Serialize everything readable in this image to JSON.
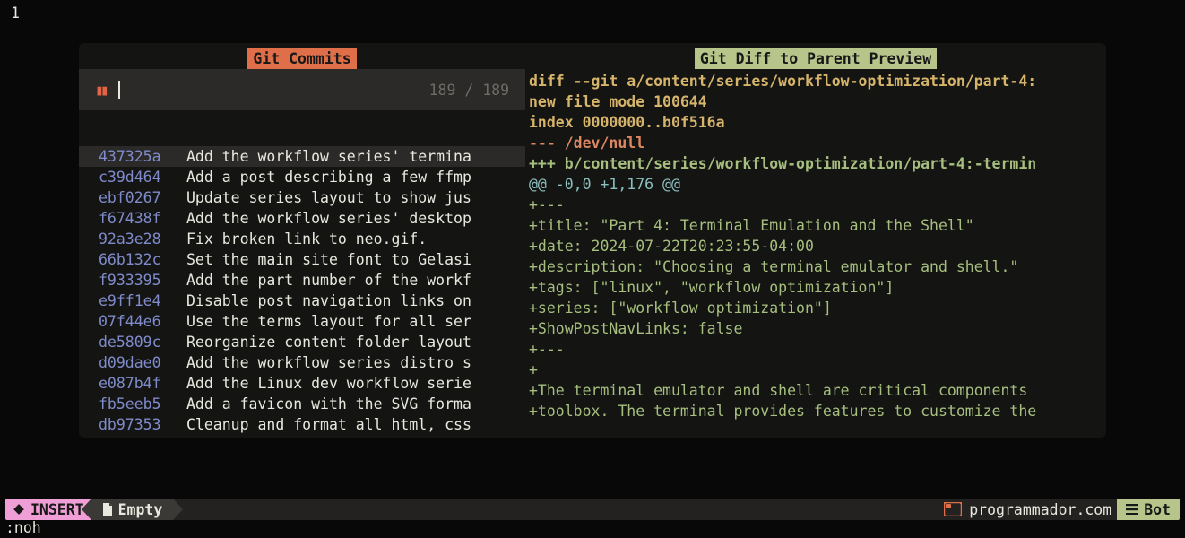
{
  "gutter_line": "1",
  "left": {
    "title": "Git Commits",
    "search": {
      "icon": "⫼",
      "count": "189 / 189"
    },
    "commits": [
      {
        "hash": "437325a",
        "msg": "Add the workflow series' termina",
        "active": true
      },
      {
        "hash": "c39d464",
        "msg": "Add a post describing a few ffmp"
      },
      {
        "hash": "ebf0267",
        "msg": "Update series layout to show jus"
      },
      {
        "hash": "f67438f",
        "msg": "Add the workflow series' desktop"
      },
      {
        "hash": "92a3e28",
        "msg": "Fix broken link to neo.gif."
      },
      {
        "hash": "66b132c",
        "msg": "Set the main site font to Gelasi"
      },
      {
        "hash": "f933395",
        "msg": "Add the part number of the workf"
      },
      {
        "hash": "e9ff1e4",
        "msg": "Disable post navigation links on"
      },
      {
        "hash": "07f44e6",
        "msg": "Use the terms layout for all ser"
      },
      {
        "hash": "de5809c",
        "msg": "Reorganize content folder layout"
      },
      {
        "hash": "d09dae0",
        "msg": "Add the workflow series distro s"
      },
      {
        "hash": "e087b4f",
        "msg": "Add the Linux dev workflow serie"
      },
      {
        "hash": "fb5eeb5",
        "msg": "Add a favicon with the SVG forma"
      },
      {
        "hash": "db97353",
        "msg": "Cleanup and format all html, css"
      }
    ]
  },
  "right": {
    "title": "Git Diff to Parent Preview",
    "lines": [
      {
        "cls": "c-yellow",
        "text": "diff --git a/content/series/workflow-optimization/part-4:"
      },
      {
        "cls": "c-yellow",
        "text": "new file mode 100644"
      },
      {
        "cls": "c-yellow",
        "text": "index 0000000..b0f516a"
      },
      {
        "cls": "c-orange",
        "text": "--- /dev/null"
      },
      {
        "cls": "c-greenB",
        "text": "+++ b/content/series/workflow-optimization/part-4:-termin"
      },
      {
        "cls": "c-teal",
        "text": "@@ -0,0 +1,176 @@"
      },
      {
        "cls": "c-green",
        "text": "+---"
      },
      {
        "cls": "c-green",
        "text": "+title: \"Part 4: Terminal Emulation and the Shell\""
      },
      {
        "cls": "c-green",
        "text": "+date: 2024-07-22T20:23:55-04:00"
      },
      {
        "cls": "c-green",
        "text": "+description: \"Choosing a terminal emulator and shell.\""
      },
      {
        "cls": "c-green",
        "text": "+tags: [\"linux\", \"workflow optimization\"]"
      },
      {
        "cls": "c-green",
        "text": "+series: [\"workflow optimization\"]"
      },
      {
        "cls": "c-green",
        "text": "+ShowPostNavLinks: false"
      },
      {
        "cls": "c-green",
        "text": "+---"
      },
      {
        "cls": "c-green",
        "text": "+"
      },
      {
        "cls": "c-green",
        "text": "+The terminal emulator and shell are critical components"
      },
      {
        "cls": "c-green",
        "text": "+toolbox. The terminal provides features to customize the"
      }
    ]
  },
  "statusline": {
    "mode": "INSERT",
    "branch": "Empty",
    "url": "programmador.com",
    "pos": "Bot"
  },
  "cmdline": ":noh"
}
